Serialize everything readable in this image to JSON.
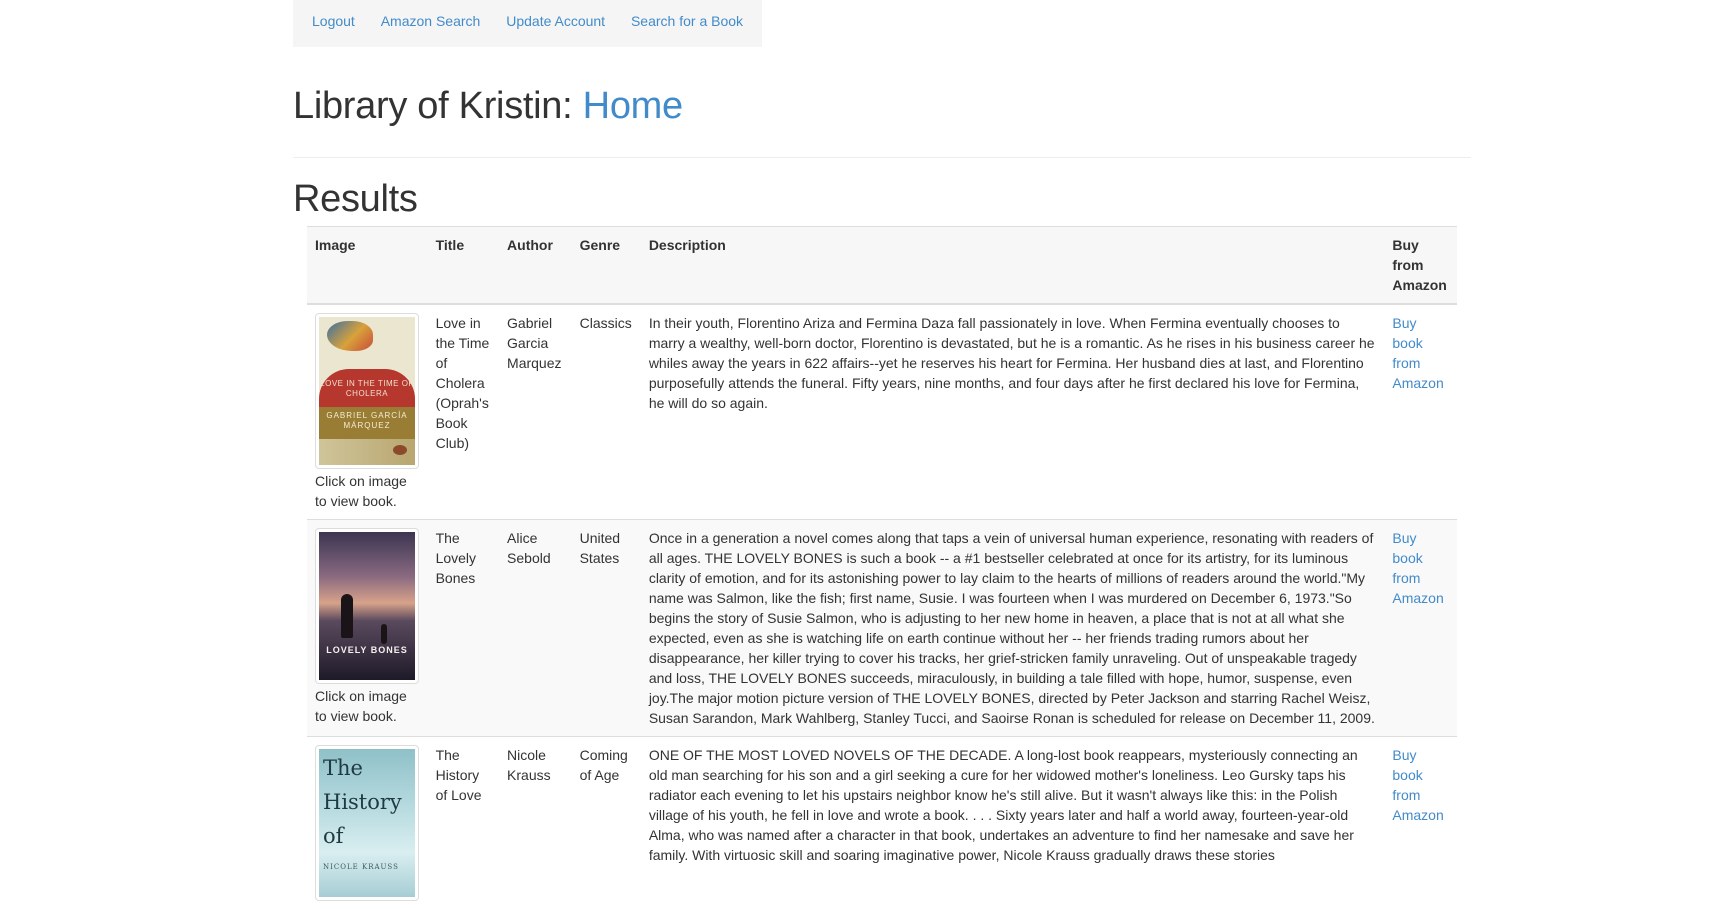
{
  "nav": {
    "items": [
      "Logout",
      "Amazon Search",
      "Update Account",
      "Search for a Book"
    ]
  },
  "header": {
    "prefix": "Library of Kristin:",
    "accent": "Home"
  },
  "results": {
    "heading": "Results",
    "columns": {
      "image": "Image",
      "title": "Title",
      "author": "Author",
      "genre": "Genre",
      "description": "Description",
      "buy": "Buy from Amazon"
    },
    "caption": "Click on image to view book.",
    "buy_label": "Buy book from Amazon",
    "rows": [
      {
        "title": "Love in the Time of Cholera (Oprah's Book Club)",
        "author": "Gabriel Garcia Marquez",
        "genre": "Classics",
        "description": "In their youth, Florentino Ariza and Fermina Daza fall passionately in love. When Fermina eventually chooses to marry a wealthy, well-born doctor, Florentino is devastated, but he is a romantic. As he rises in his business career he whiles away the years in 622 affairs--yet he reserves his heart for Fermina. Her husband dies at last, and Florentino purposefully attends the funeral. Fifty years, nine months, and four days after he first declared his love for Fermina, he will do so again.",
        "cover": {
          "top_text": "LOVE IN THE TIME OF CHOLERA",
          "band_text": "GABRIEL GARCÍA MÁRQUEZ"
        }
      },
      {
        "title": "The Lovely Bones",
        "author": "Alice Sebold",
        "genre": "United States",
        "description": "Once in a generation a novel comes along that taps a vein of universal human experience, resonating with readers of all ages. THE LOVELY BONES is such a book -- a #1 bestseller celebrated at once for its artistry, for its luminous clarity of emotion, and for its astonishing power to lay claim to the hearts of millions of readers around the world.\"My name was Salmon, like the fish; first name, Susie. I was fourteen when I was murdered on December 6, 1973.\"So begins the story of Susie Salmon, who is adjusting to her new home in heaven, a place that is not at all what she expected, even as she is watching life on earth continue without her -- her friends trading rumors about her disappearance, her killer trying to cover his tracks, her grief-stricken family unraveling. Out of unspeakable tragedy and loss, THE LOVELY BONES succeeds, miraculously, in building a tale filled with hope, humor, suspense, even joy.The major motion picture version of THE LOVELY BONES, directed by Peter Jackson and starring Rachel Weisz, Susan Sarandon, Mark Wahlberg, Stanley Tucci, and Saoirse Ronan is scheduled for release on December 11, 2009.",
        "cover": {
          "title_text": "LOVELY BONES"
        }
      },
      {
        "title": "The History of Love",
        "author": "Nicole Krauss",
        "genre": "Coming of Age",
        "description": "ONE OF THE MOST LOVED NOVELS OF THE DECADE.  A long-lost book reappears, mysteriously connecting an old man searching for his son and a girl seeking a cure for her widowed mother's loneliness. Leo Gursky taps his radiator each evening to let his upstairs neighbor know he's still alive. But it wasn't always like this: in the Polish village of his youth, he fell in love and wrote a book. . . . Sixty years later and half a world away, fourteen-year-old Alma, who was named after a character in that book, undertakes an adventure to find her namesake and save her family. With virtuosic skill and soaring imaginative power, Nicole Krauss gradually draws these stories",
        "cover": {
          "line1": "The",
          "line2": "History",
          "line3": "of",
          "author_text": "NICOLE KRAUSS"
        }
      }
    ]
  }
}
